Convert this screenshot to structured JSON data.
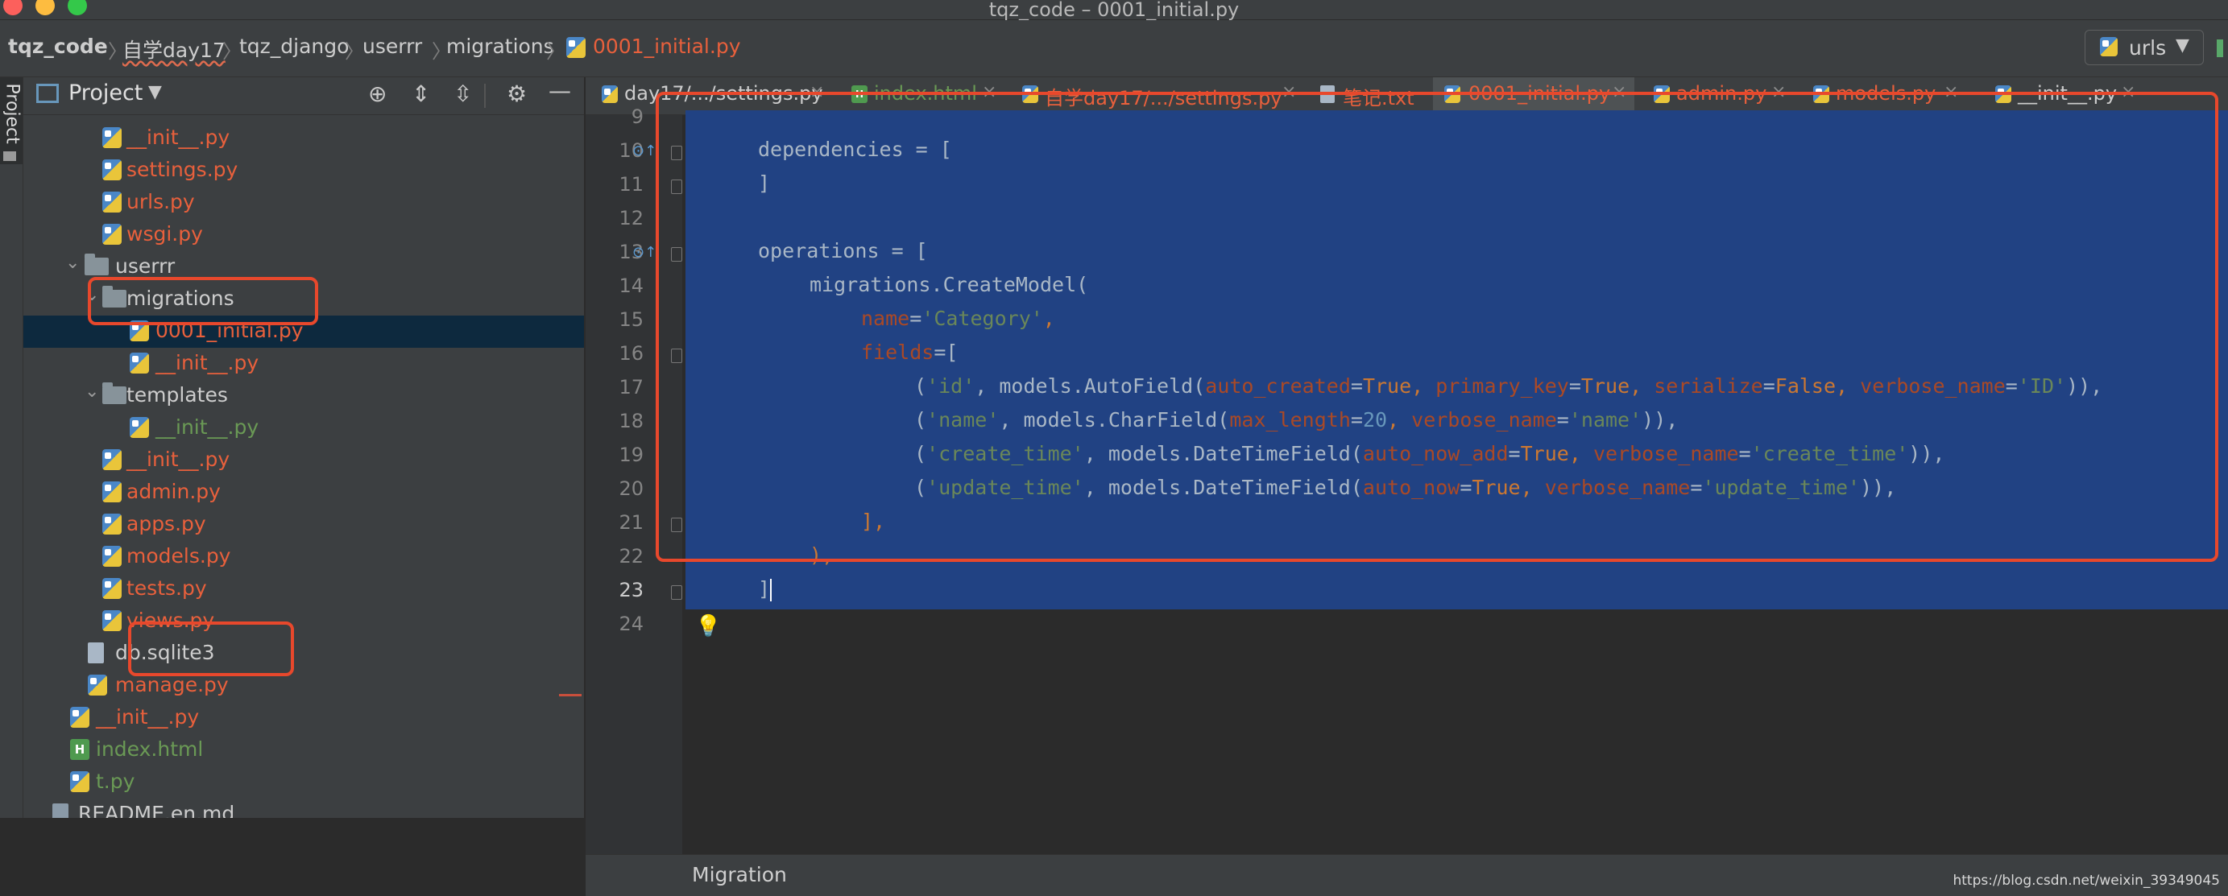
{
  "window": {
    "title": "tqz_code – 0001_initial.py"
  },
  "breadcrumb": {
    "items": [
      {
        "label": "tqz_code"
      },
      {
        "label": "自学day17"
      },
      {
        "label": "tqz_django"
      },
      {
        "label": "userrr"
      },
      {
        "label": "migrations"
      },
      {
        "label": "0001_initial.py"
      }
    ]
  },
  "run_config": {
    "label": "urls"
  },
  "side_stripe": {
    "label": "Project"
  },
  "project_panel": {
    "title": "Project",
    "tree": [
      {
        "label": "__init__.py",
        "icon": "python-file-icon"
      },
      {
        "label": "settings.py",
        "icon": "python-file-icon"
      },
      {
        "label": "urls.py",
        "icon": "python-file-icon"
      },
      {
        "label": "wsgi.py",
        "icon": "python-file-icon"
      },
      {
        "label": "userrr",
        "icon": "folder-icon"
      },
      {
        "label": "migrations",
        "icon": "folder-icon"
      },
      {
        "label": "0001_initial.py",
        "icon": "python-file-icon"
      },
      {
        "label": "__init__.py",
        "icon": "python-file-icon"
      },
      {
        "label": "templates",
        "icon": "folder-icon"
      },
      {
        "label": "__init__.py",
        "icon": "python-file-icon"
      },
      {
        "label": "__init__.py",
        "icon": "python-file-icon"
      },
      {
        "label": "admin.py",
        "icon": "python-file-icon"
      },
      {
        "label": "apps.py",
        "icon": "python-file-icon"
      },
      {
        "label": "models.py",
        "icon": "python-file-icon"
      },
      {
        "label": "tests.py",
        "icon": "python-file-icon"
      },
      {
        "label": "views.py",
        "icon": "python-file-icon"
      },
      {
        "label": "db.sqlite3",
        "icon": "database-file-icon"
      },
      {
        "label": "manage.py",
        "icon": "python-file-icon"
      },
      {
        "label": "__init__.py",
        "icon": "python-file-icon"
      },
      {
        "label": "index.html",
        "icon": "html-file-icon"
      },
      {
        "label": "t.py",
        "icon": "python-file-icon"
      },
      {
        "label": "README.en.md",
        "icon": "markdown-file-icon"
      }
    ]
  },
  "tabs": [
    {
      "label": "day17/.../settings.py",
      "icon": "python-file-icon"
    },
    {
      "label": "index.html",
      "icon": "html-file-icon"
    },
    {
      "label": "自学day17/.../settings.py",
      "icon": "python-file-icon"
    },
    {
      "label": "笔记.txt",
      "icon": "text-file-icon"
    },
    {
      "label": "0001_initial.py",
      "icon": "python-file-icon",
      "active": true
    },
    {
      "label": "admin.py",
      "icon": "python-file-icon"
    },
    {
      "label": "models.py",
      "icon": "python-file-icon"
    },
    {
      "label": "__init__.py",
      "icon": "python-file-icon"
    }
  ],
  "editor": {
    "line_numbers": [
      "9",
      "10",
      "11",
      "12",
      "13",
      "14",
      "15",
      "16",
      "17",
      "18",
      "19",
      "20",
      "21",
      "22",
      "23",
      "24"
    ],
    "code": {
      "l10_a": "dependencies",
      "l10_b": " = [",
      "l11": "]",
      "l13_a": "operations",
      "l13_b": " = [",
      "l14": "migrations.CreateModel(",
      "l15_p": "name",
      "l15_eq": "=",
      "l15_s": "'Category'",
      "l15_end": ",",
      "l16_p": "fields",
      "l16_end": "=[",
      "l17_open": "(",
      "l17_s1": "'id'",
      "l17_mid": ", models.AutoField(",
      "l17_p1": "auto_created",
      "l17_eq1": "=",
      "l17_v1": "True",
      "l17_c1": ", ",
      "l17_p2": "primary_key",
      "l17_eq2": "=",
      "l17_v2": "True",
      "l17_c2": ", ",
      "l17_p3": "serialize",
      "l17_eq3": "=",
      "l17_v3": "False",
      "l17_c3": ", ",
      "l17_p4": "verbose_name",
      "l17_eq4": "=",
      "l17_s2": "'ID'",
      "l17_end": ")),",
      "l18_open": "(",
      "l18_s1": "'name'",
      "l18_mid": ", models.CharField(",
      "l18_p1": "max_length",
      "l18_eq1": "=",
      "l18_n1": "20",
      "l18_c1": ", ",
      "l18_p2": "verbose_name",
      "l18_eq2": "=",
      "l18_s2": "'name'",
      "l18_end": ")),",
      "l19_open": "(",
      "l19_s1": "'create_time'",
      "l19_mid": ", models.DateTimeField(",
      "l19_p1": "auto_now_add",
      "l19_eq1": "=",
      "l19_v1": "True",
      "l19_c1": ", ",
      "l19_p2": "verbose_name",
      "l19_eq2": "=",
      "l19_s2": "'create_time'",
      "l19_end": ")),",
      "l20_open": "(",
      "l20_s1": "'update_time'",
      "l20_mid": ", models.DateTimeField(",
      "l20_p1": "auto_now",
      "l20_eq1": "=",
      "l20_v1": "True",
      "l20_c1": ", ",
      "l20_p2": "verbose_name",
      "l20_eq2": "=",
      "l20_s2": "'update_time'",
      "l20_end": ")),",
      "l21": "],",
      "l22": "),",
      "l23": "]"
    }
  },
  "status_bar": {
    "breadcrumb": "Migration",
    "watermark": "https://blog.csdn.net/weixin_39349045"
  },
  "colors": {
    "highlight_box": "#e8482c",
    "selection": "#214283",
    "python_file_text": "#e8603c"
  }
}
